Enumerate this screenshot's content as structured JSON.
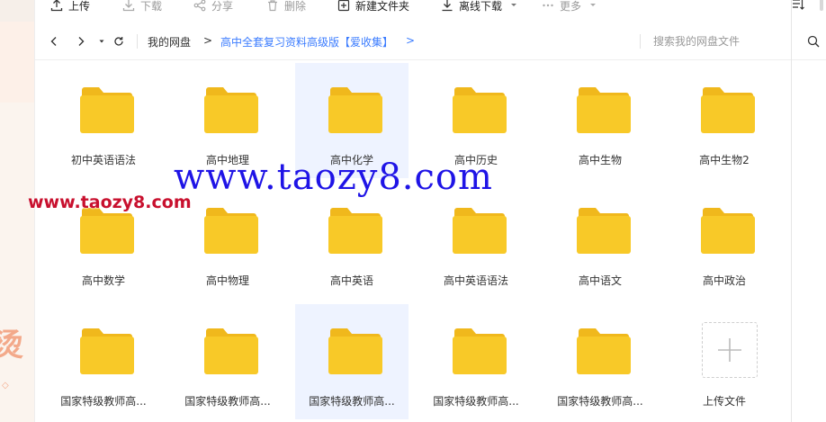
{
  "toolbar": {
    "items": [
      {
        "label": "上传",
        "icon": "upload-icon",
        "state": "enabled"
      },
      {
        "label": "下载",
        "icon": "download-icon",
        "state": "disabled"
      },
      {
        "label": "分享",
        "icon": "share-icon",
        "state": "disabled"
      },
      {
        "label": "删除",
        "icon": "trash-icon",
        "state": "disabled"
      },
      {
        "label": "新建文件夹",
        "icon": "new-folder-icon",
        "state": "enabled"
      },
      {
        "label": "离线下载",
        "icon": "offline-download-icon",
        "state": "enabled"
      },
      {
        "label": "更多",
        "icon": "more-icon",
        "state": "disabled"
      }
    ]
  },
  "address": {
    "root": "我的网盘",
    "arrow": ">",
    "current": "高中全套复习资料高级版【爱收集】",
    "more": ">",
    "search_placeholder": "搜索我的网盘文件"
  },
  "files": [
    {
      "name": "初中英语语法",
      "type": "folder",
      "selected": false
    },
    {
      "name": "高中地理",
      "type": "folder",
      "selected": false
    },
    {
      "name": "高中化学",
      "type": "folder",
      "selected": true
    },
    {
      "name": "高中历史",
      "type": "folder",
      "selected": false
    },
    {
      "name": "高中生物",
      "type": "folder",
      "selected": false
    },
    {
      "name": "高中生物2",
      "type": "folder",
      "selected": false
    },
    {
      "name": "高中数学",
      "type": "folder",
      "selected": false
    },
    {
      "name": "高中物理",
      "type": "folder",
      "selected": false
    },
    {
      "name": "高中英语",
      "type": "folder",
      "selected": false
    },
    {
      "name": "高中英语语法",
      "type": "folder",
      "selected": false
    },
    {
      "name": "高中语文",
      "type": "folder",
      "selected": false
    },
    {
      "name": "高中政治",
      "type": "folder",
      "selected": false
    },
    {
      "name": "国家特级教师高...",
      "type": "folder",
      "selected": false
    },
    {
      "name": "国家特级教师高...",
      "type": "folder",
      "selected": false
    },
    {
      "name": "国家特级教师高...",
      "type": "folder",
      "selected": true
    },
    {
      "name": "国家特级教师高...",
      "type": "folder",
      "selected": false
    },
    {
      "name": "国家特级教师高...",
      "type": "folder",
      "selected": false
    }
  ],
  "upload_tile": {
    "label": "上传文件"
  },
  "watermark": {
    "large": "www.taozy8.com",
    "small": "www.taozy8.com"
  },
  "sidebar_glyph": "烫",
  "colors": {
    "folder": "#f8c928",
    "folder_tab": "#f0b81c",
    "accent": "#3b7cff",
    "selected_bg": "#eef3ff",
    "watermark_large": "#1f14e6",
    "watermark_small": "#c8102e"
  }
}
